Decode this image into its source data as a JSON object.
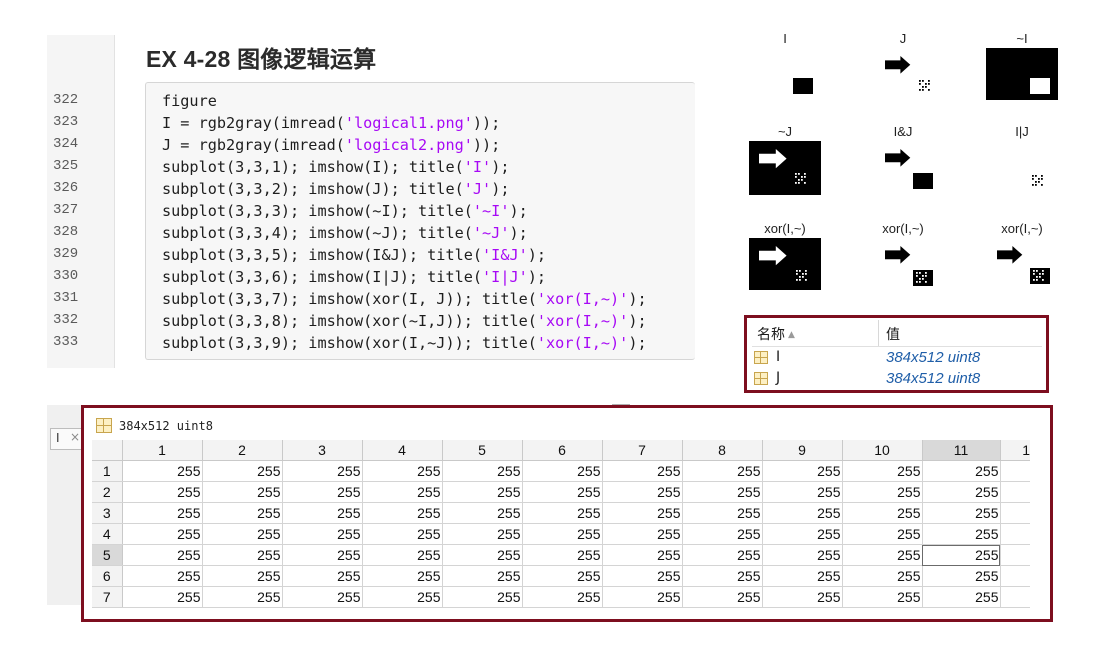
{
  "code": {
    "section_title": "EX 4-28 图像逻辑运算",
    "line_numbers": [
      "322",
      "323",
      "324",
      "325",
      "326",
      "327",
      "328",
      "329",
      "330",
      "331",
      "332"
    ],
    "last_line_number": "333",
    "lines": [
      [
        {
          "t": "figure"
        }
      ],
      [
        {
          "t": "I = rgb2gray(imread("
        },
        {
          "t": "'logical1.png'",
          "s": true
        },
        {
          "t": "));"
        }
      ],
      [
        {
          "t": "J = rgb2gray(imread("
        },
        {
          "t": "'logical2.png'",
          "s": true
        },
        {
          "t": "));"
        }
      ],
      [
        {
          "t": "subplot(3,3,1); imshow(I); title("
        },
        {
          "t": "'I'",
          "s": true
        },
        {
          "t": ");"
        }
      ],
      [
        {
          "t": "subplot(3,3,2); imshow(J); title("
        },
        {
          "t": "'J'",
          "s": true
        },
        {
          "t": ");"
        }
      ],
      [
        {
          "t": "subplot(3,3,3); imshow(~I); title("
        },
        {
          "t": "'~I'",
          "s": true
        },
        {
          "t": ");"
        }
      ],
      [
        {
          "t": "subplot(3,3,4); imshow(~J); title("
        },
        {
          "t": "'~J'",
          "s": true
        },
        {
          "t": ");"
        }
      ],
      [
        {
          "t": "subplot(3,3,5); imshow(I&J); title("
        },
        {
          "t": "'I&J'",
          "s": true
        },
        {
          "t": ");"
        }
      ],
      [
        {
          "t": "subplot(3,3,6); imshow(I|J); title("
        },
        {
          "t": "'I|J'",
          "s": true
        },
        {
          "t": ");"
        }
      ],
      [
        {
          "t": "subplot(3,3,7); imshow(xor(I, J)); title("
        },
        {
          "t": "'xor(I,~)'",
          "s": true
        },
        {
          "t": ");"
        }
      ],
      [
        {
          "t": "subplot(3,3,8); imshow(xor(~I,J)); title("
        },
        {
          "t": "'xor(I,~)'",
          "s": true
        },
        {
          "t": ");"
        }
      ],
      [
        {
          "t": "subplot(3,3,9); imshow(xor(I,~J)); title("
        },
        {
          "t": "'xor(I,~)'",
          "s": true
        },
        {
          "t": ");"
        }
      ]
    ]
  },
  "figure": {
    "subplots": [
      {
        "title": "I",
        "variant": "I"
      },
      {
        "title": "J",
        "variant": "J"
      },
      {
        "title": "~I",
        "variant": "notI"
      },
      {
        "title": "~J",
        "variant": "notJ"
      },
      {
        "title": "I&J",
        "variant": "and"
      },
      {
        "title": "I|J",
        "variant": "or"
      },
      {
        "title": "xor(I,~)",
        "variant": "xor1"
      },
      {
        "title": "xor(I,~)",
        "variant": "xor2"
      },
      {
        "title": "xor(I,~)",
        "variant": "xor3"
      }
    ]
  },
  "workspace": {
    "col_name": "名称",
    "col_sort_icon": "▲",
    "col_value": "值",
    "variables": [
      {
        "name": "I",
        "value": "384x512 uint8"
      },
      {
        "name": "J",
        "value": "384x512 uint8"
      }
    ]
  },
  "editor": {
    "tab_label": "I",
    "tab_close": "×",
    "title": "384x512 uint8",
    "columns": [
      "1",
      "2",
      "3",
      "4",
      "5",
      "6",
      "7",
      "8",
      "9",
      "10",
      "11",
      "1"
    ],
    "selected_column": "11",
    "selected_row": "5",
    "active_cell": {
      "row": "5",
      "col": "11"
    },
    "rows": [
      {
        "label": "1",
        "values": [
          "255",
          "255",
          "255",
          "255",
          "255",
          "255",
          "255",
          "255",
          "255",
          "255",
          "255"
        ]
      },
      {
        "label": "2",
        "values": [
          "255",
          "255",
          "255",
          "255",
          "255",
          "255",
          "255",
          "255",
          "255",
          "255",
          "255"
        ]
      },
      {
        "label": "3",
        "values": [
          "255",
          "255",
          "255",
          "255",
          "255",
          "255",
          "255",
          "255",
          "255",
          "255",
          "255"
        ]
      },
      {
        "label": "4",
        "values": [
          "255",
          "255",
          "255",
          "255",
          "255",
          "255",
          "255",
          "255",
          "255",
          "255",
          "255"
        ]
      },
      {
        "label": "5",
        "values": [
          "255",
          "255",
          "255",
          "255",
          "255",
          "255",
          "255",
          "255",
          "255",
          "255",
          "255"
        ]
      },
      {
        "label": "6",
        "values": [
          "255",
          "255",
          "255",
          "255",
          "255",
          "255",
          "255",
          "255",
          "255",
          "255",
          "255"
        ]
      },
      {
        "label": "7",
        "values": [
          "255",
          "255",
          "255",
          "255",
          "255",
          "255",
          "255",
          "255",
          "255",
          "255",
          "255"
        ]
      }
    ]
  },
  "colors": {
    "highlight_border": "#7d0e1f",
    "string_literal": "#a709f5",
    "workspace_value": "#1f5ea8"
  }
}
